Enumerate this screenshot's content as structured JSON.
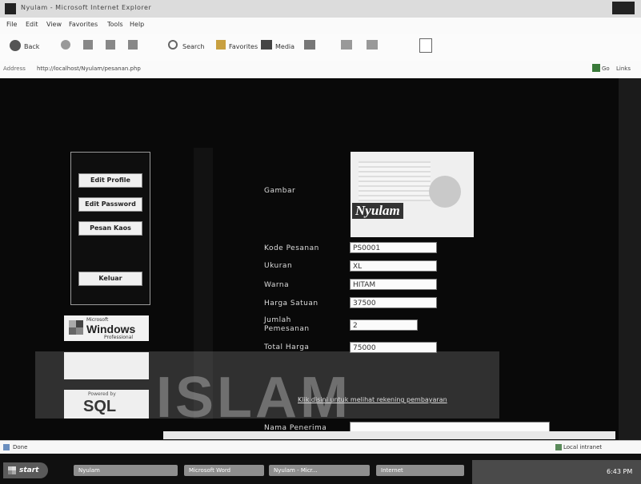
{
  "window": {
    "title": "Nyulam - Microsoft Internet Explorer"
  },
  "menu": [
    {
      "label": "File"
    },
    {
      "label": "Edit"
    },
    {
      "label": "View"
    },
    {
      "label": "Favorites"
    },
    {
      "label": "Tools"
    },
    {
      "label": "Help"
    }
  ],
  "toolbar": {
    "back": "Back",
    "search": "Search",
    "favorites": "Favorites",
    "media": "Media"
  },
  "address": {
    "label": "Address",
    "url": "http://localhost/Nyulam/pesanan.php",
    "go": "Go",
    "links": "Links"
  },
  "sidebar": {
    "buttons": [
      {
        "label": "Edit Profile"
      },
      {
        "label": "Edit Password"
      },
      {
        "label": "Pesan Kaos"
      },
      {
        "label": "Keluar"
      }
    ],
    "windows_logo": {
      "small": "Microsoft",
      "brand": "Windows",
      "edition": "Professional"
    },
    "sql_logo": {
      "powered": "Powered by",
      "brand": "SQL"
    }
  },
  "form": {
    "image_label": "Gambar",
    "image_caption": "Nyulam",
    "fields": [
      {
        "label": "Kode Pesanan",
        "value": "PS0001"
      },
      {
        "label": "Ukuran",
        "value": "XL"
      },
      {
        "label": "Warna",
        "value": "HITAM"
      },
      {
        "label": "Harga Satuan",
        "value": "37500"
      },
      {
        "label": "Jumlah Pemesanan",
        "value": "2"
      },
      {
        "label": "Total Harga",
        "value": "75000"
      }
    ],
    "link": "Klik disini untuk melihat rekening pembayaran",
    "recipient_label": "Nama Penerima"
  },
  "watermark": "ISLAM",
  "status": {
    "left": "Done",
    "right": "Local intranet"
  },
  "taskbar": {
    "start": "start",
    "items": [
      {
        "label": "Nyulam"
      },
      {
        "label": "Microsoft Word"
      },
      {
        "label": "Nyulam - Micr..."
      },
      {
        "label": "Internet"
      }
    ],
    "clock": "6:43 PM"
  }
}
